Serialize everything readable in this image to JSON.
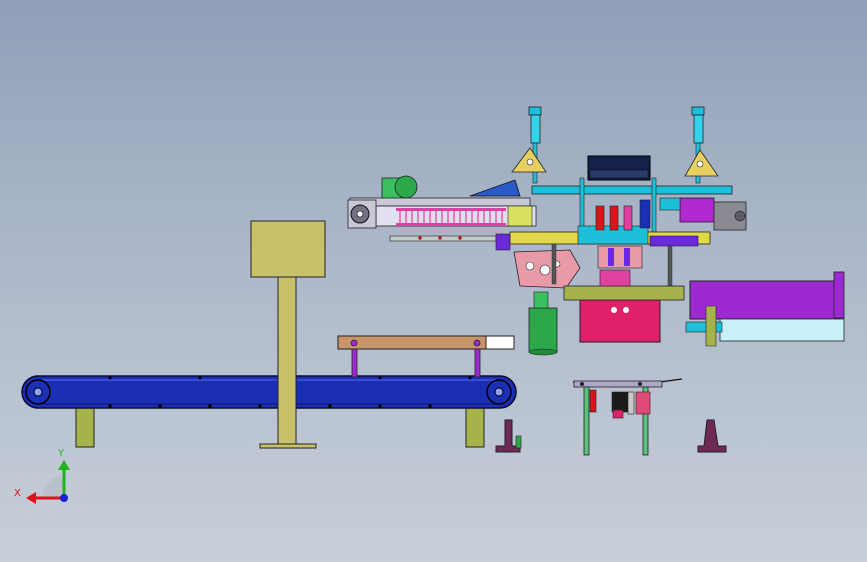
{
  "triad": {
    "x_label": "X",
    "y_label": "Y",
    "x_color": "#d8141c",
    "y_color": "#1fb41f",
    "z_color": "#1c1cd8"
  },
  "colors": {
    "background_top": "#8f9fb8",
    "background_bottom": "#c8cfd9",
    "conveyor": "#1a2fb4",
    "support": "#a8b24a",
    "stand_base": "#6e2a55",
    "magenta_housing": "#e0206a",
    "purple_hopper": "#9c2ad0",
    "cyan_frame": "#1ebfd8",
    "wood_table": "#c8956a",
    "green_motor": "#2aa84a"
  }
}
